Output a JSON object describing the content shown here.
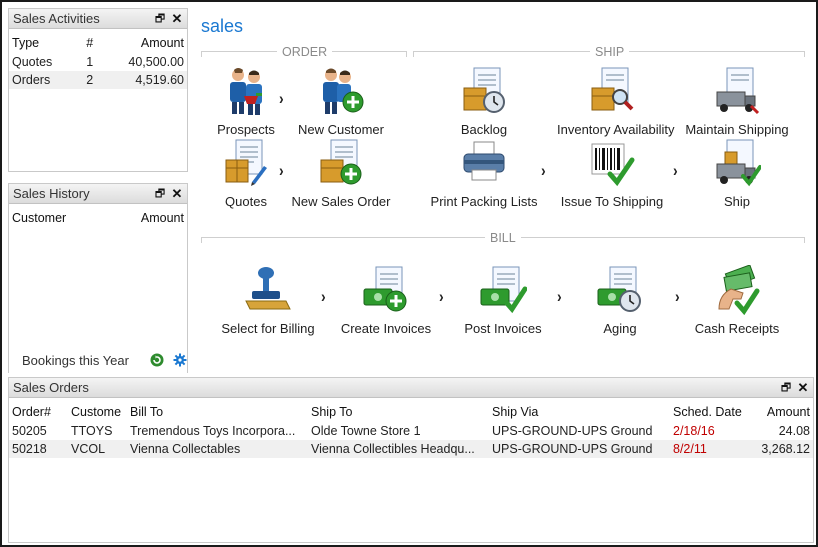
{
  "sales_activities": {
    "title": "Sales Activities",
    "columns": [
      "Type",
      "#",
      "Amount"
    ],
    "rows": [
      {
        "type": "Quotes",
        "count": "1",
        "amount": "40,500.00"
      },
      {
        "type": "Orders",
        "count": "2",
        "amount": "4,519.60"
      }
    ]
  },
  "sales_history": {
    "title": "Sales History",
    "columns": [
      "Customer",
      "Amount"
    ]
  },
  "bookings": {
    "label": "Bookings this Year"
  },
  "main": {
    "title": "sales",
    "sections": {
      "order": "ORDER",
      "ship": "SHIP",
      "bill": "BILL"
    },
    "actions": {
      "prospects": "Prospects",
      "new_customer": "New Customer",
      "quotes": "Quotes",
      "new_sales_order": "New Sales Order",
      "backlog": "Backlog",
      "inventory_availability": "Inventory Availability",
      "maintain_shipping": "Maintain Shipping",
      "print_packing_lists": "Print Packing Lists",
      "issue_to_shipping": "Issue To Shipping",
      "ship": "Ship",
      "select_for_billing": "Select for Billing",
      "create_invoices": "Create Invoices",
      "post_invoices": "Post Invoices",
      "aging": "Aging",
      "cash_receipts": "Cash Receipts"
    }
  },
  "sales_orders": {
    "title": "Sales Orders",
    "columns": [
      "Order#",
      "Custome",
      "Bill To",
      "Ship To",
      "Ship Via",
      "Sched. Date",
      "Amount"
    ],
    "rows": [
      {
        "order": "50205",
        "customer": "TTOYS",
        "bill_to": "Tremendous Toys Incorpora...",
        "ship_to": "Olde Towne Store 1",
        "ship_via": "UPS-GROUND-UPS Ground",
        "sched_date": "2/18/16",
        "amount": "24.08"
      },
      {
        "order": "50218",
        "customer": "VCOL",
        "bill_to": "Vienna Collectables",
        "ship_to": "Vienna Collectibles Headqu...",
        "ship_via": "UPS-GROUND-UPS Ground",
        "sched_date": "8/2/11",
        "amount": "3,268.12"
      }
    ]
  },
  "colors": {
    "title_blue": "#1a78d1",
    "late_date_red": "#c00000",
    "action_green": "#2e9b2e"
  },
  "icons": {
    "restore": "restore-icon",
    "close": "close-icon",
    "refresh": "refresh-icon",
    "settings": "gear-icon"
  }
}
